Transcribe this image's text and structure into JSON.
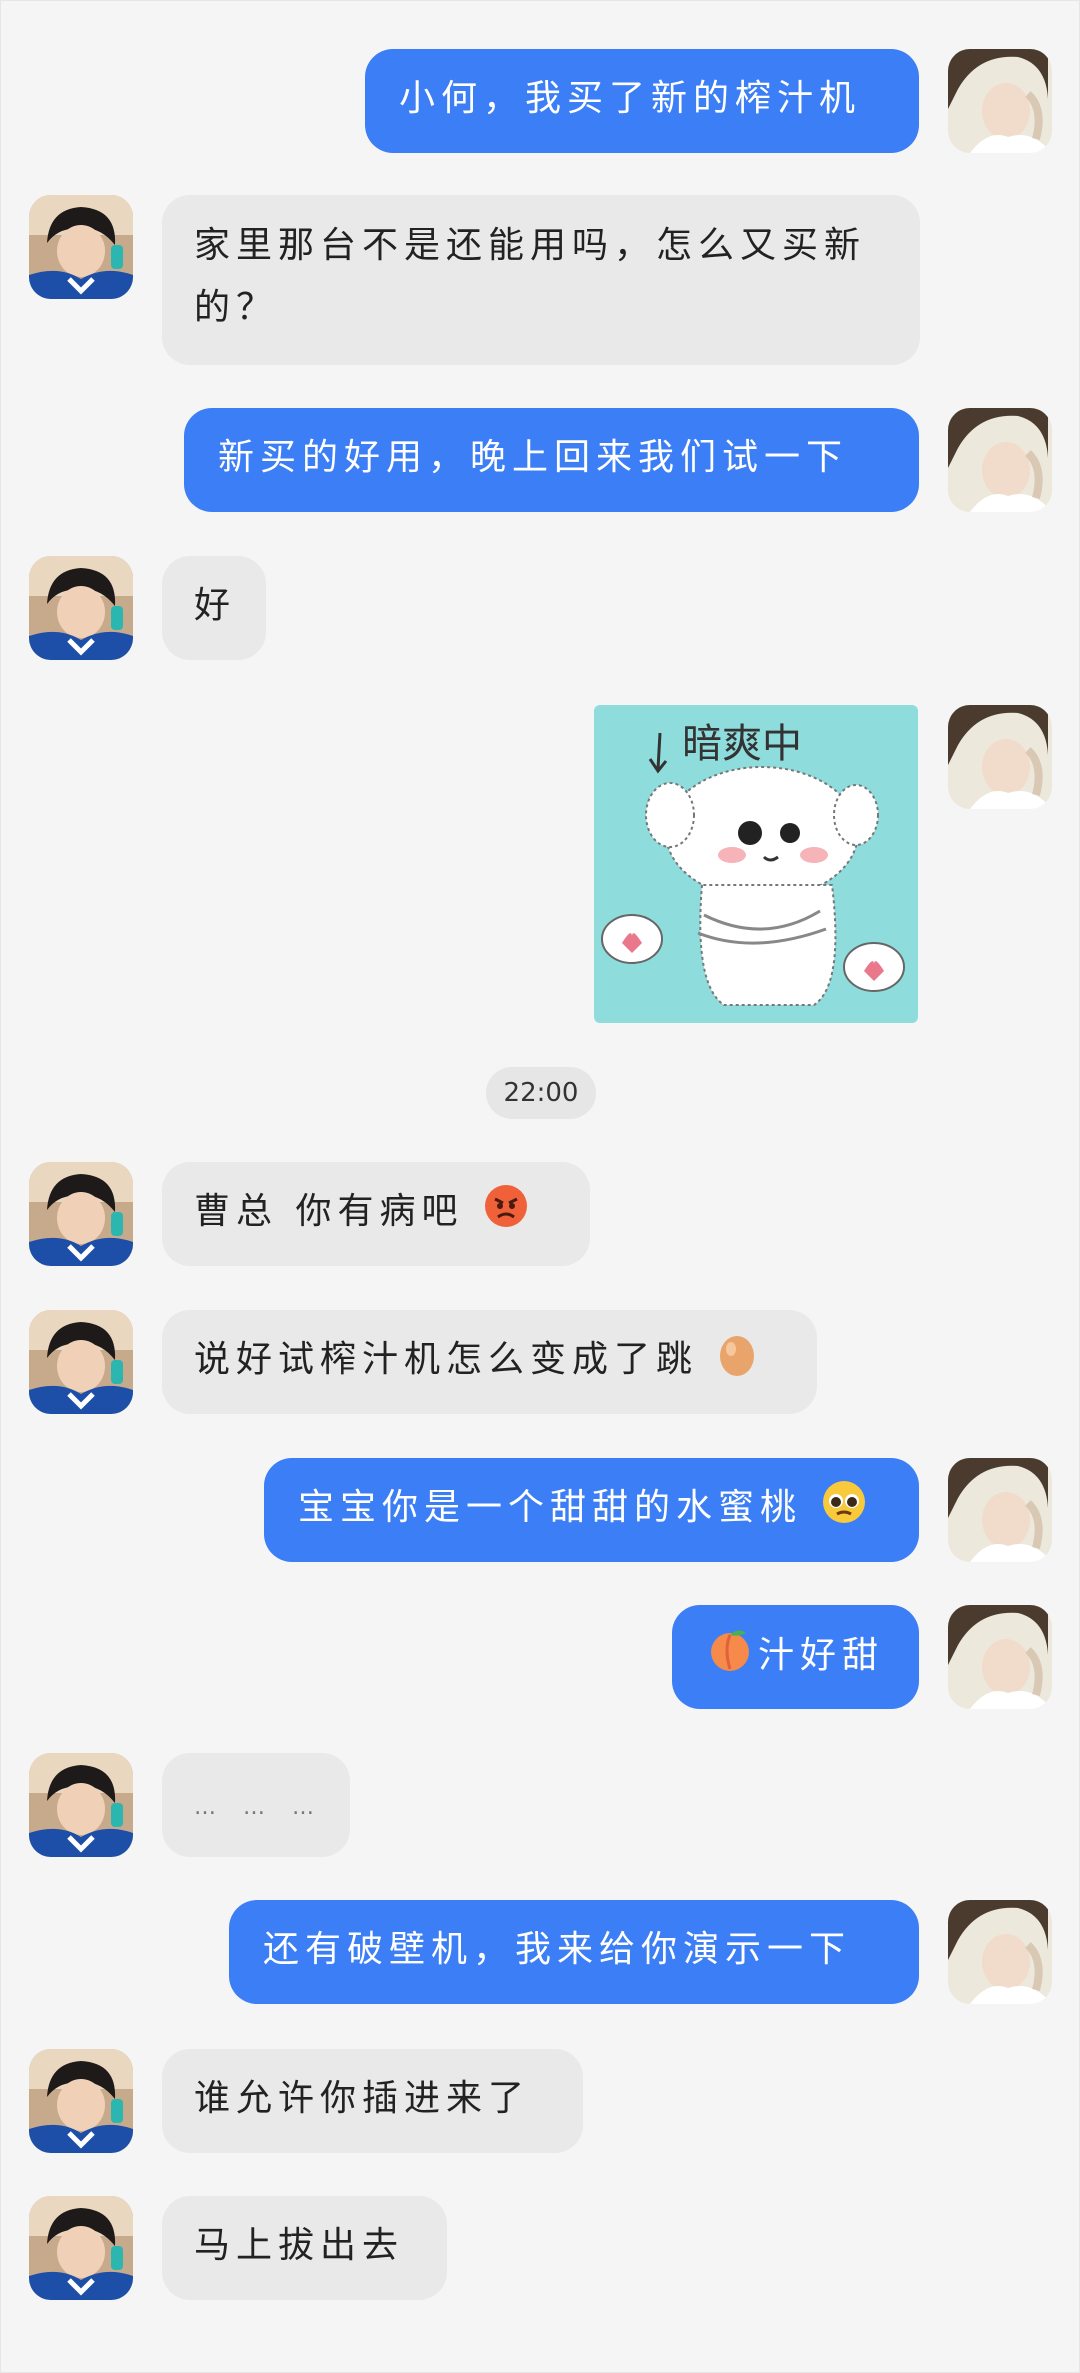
{
  "chat": {
    "messages": [
      {
        "side": "out",
        "text": "小何，我买了新的榨汁机"
      },
      {
        "side": "in",
        "text": "家里那台不是还能用吗，怎么又买新的？"
      },
      {
        "side": "out",
        "text": "新买的好用，晚上回来我们试一下"
      },
      {
        "side": "in",
        "text": "好"
      },
      {
        "side": "out",
        "type": "sticker",
        "caption": "暗爽中"
      },
      {
        "type": "time",
        "text": "22:00"
      },
      {
        "side": "in",
        "text": "曹总 你有病吧",
        "emoji": "angry-face-emoji"
      },
      {
        "side": "in",
        "text": "说好试榨汁机怎么变成了跳",
        "emoji": "egg-emoji"
      },
      {
        "side": "out",
        "text": "宝宝你是一个甜甜的水蜜桃",
        "emoji": "pleading-face-emoji"
      },
      {
        "side": "out",
        "text": "汁好甜",
        "emoji_before": "peach-emoji"
      },
      {
        "side": "in",
        "text": "… … …"
      },
      {
        "side": "out",
        "text": "还有破壁机，我来给你演示一下"
      },
      {
        "side": "in",
        "text": "谁允许你插进来了"
      },
      {
        "side": "in",
        "text": "马上拔出去"
      }
    ]
  },
  "colors": {
    "outgoing_bubble": "#3b7ef6",
    "incoming_bubble": "#e9e9e9",
    "background": "#f5f5f5"
  }
}
